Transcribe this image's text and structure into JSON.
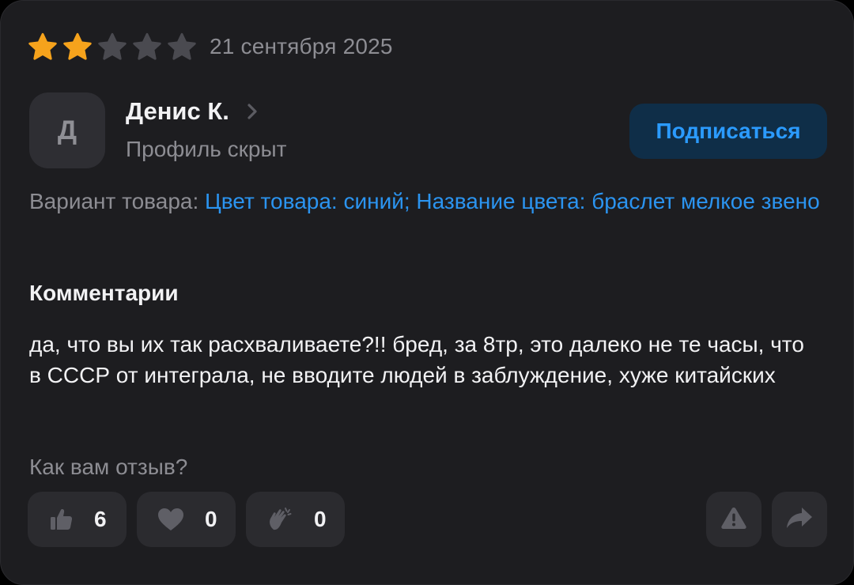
{
  "review": {
    "rating": 2,
    "max_rating": 5,
    "date": "21 сентября 2025"
  },
  "author": {
    "initial": "Д",
    "name": "Денис К.",
    "profile_status": "Профиль скрыт"
  },
  "subscribe_label": "Подписаться",
  "variant": {
    "label": "Вариант товара: ",
    "value": "Цвет товара: синий; Название цвета: браслет мелкое звено"
  },
  "comments": {
    "heading": "Комментарии",
    "text": "да, что вы их так расхваливаете?!! бред, за 8тр, это далеко не те часы, что в СССР от интеграла, не вводите людей в заблуждение, хуже китайских"
  },
  "feedback": {
    "question": "Как вам отзыв?",
    "reactions": [
      {
        "name": "like",
        "icon": "thumbs-up-icon",
        "count": "6"
      },
      {
        "name": "heart",
        "icon": "heart-icon",
        "count": "0"
      },
      {
        "name": "clap",
        "icon": "clapping-hands-icon",
        "count": "0"
      }
    ]
  },
  "colors": {
    "card_background": "#1d1d20",
    "star_filled": "#f6a31c",
    "star_empty": "#4a4a50",
    "accent_link": "#2b94f0",
    "subscribe_background": "#0f2e48"
  }
}
